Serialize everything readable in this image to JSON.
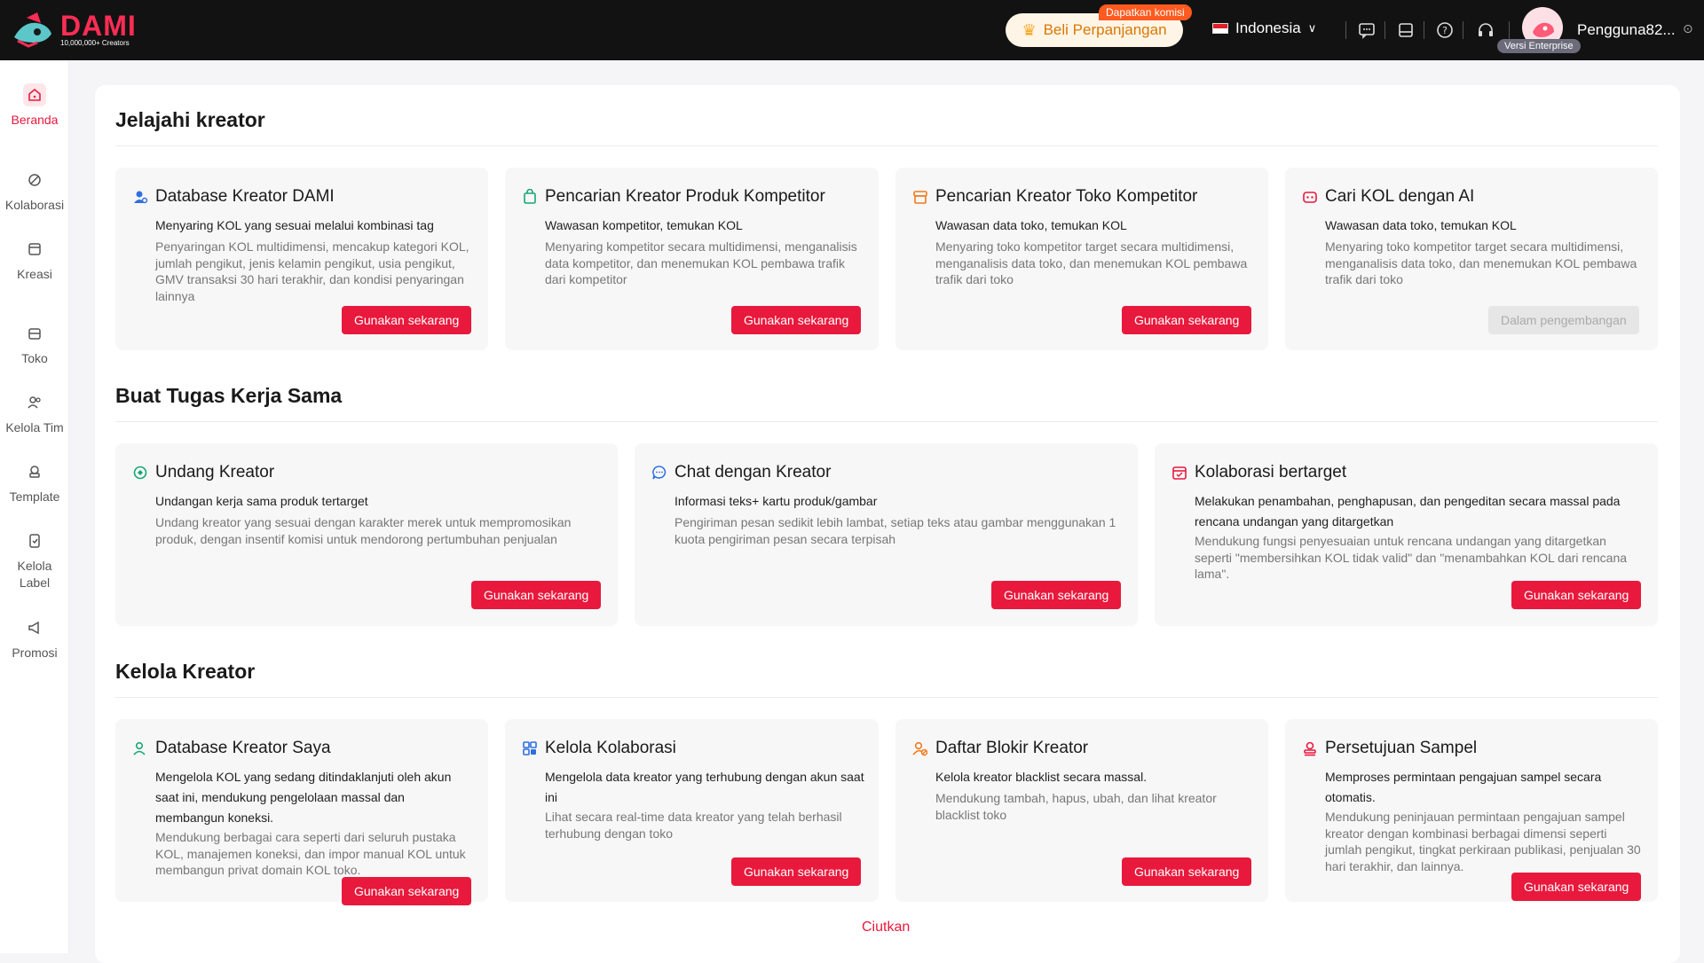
{
  "topbar": {
    "brand": "DAMI",
    "tagline": "10,000,000+ Creators",
    "renew_label": "Beli Perpanjangan",
    "commission_badge": "Dapatkan komisi",
    "language": "Indonesia",
    "username": "Pengguna82...",
    "plan_badge": "Versi Enterprise"
  },
  "sidebar": {
    "items": [
      {
        "label": "Beranda"
      },
      {
        "label": "Kolaborasi"
      },
      {
        "label": "Kreasi"
      },
      {
        "label": "Toko"
      },
      {
        "label": "Kelola Tim"
      },
      {
        "label": "Template"
      },
      {
        "label": "Kelola Label"
      },
      {
        "label": "Promosi"
      }
    ]
  },
  "sections": [
    {
      "title": "Jelajahi kreator",
      "cards": [
        {
          "title": "Database Kreator DAMI",
          "sub": "Menyaring KOL yang sesuai melalui kombinasi tag",
          "desc": "Penyaringan KOL multidimensi, mencakup kategori KOL, jumlah pengikut, jenis kelamin pengikut, usia pengikut, GMV transaksi 30 hari terakhir, dan kondisi penyaringan lainnya",
          "button": "Gunakan sekarang"
        },
        {
          "title": "Pencarian Kreator Produk Kompetitor",
          "sub": "Wawasan kompetitor, temukan KOL",
          "desc": "Menyaring kompetitor secara multidimensi, menganalisis data kompetitor, dan menemukan KOL pembawa trafik dari kompetitor",
          "button": "Gunakan sekarang"
        },
        {
          "title": "Pencarian Kreator Toko Kompetitor",
          "sub": "Wawasan data toko, temukan KOL",
          "desc": "Menyaring toko kompetitor target secara multidimensi, menganalisis data toko, dan menemukan KOL pembawa trafik dari toko",
          "button": "Gunakan sekarang"
        },
        {
          "title": "Cari KOL dengan AI",
          "sub": "Wawasan data toko, temukan KOL",
          "desc": "Menyaring toko kompetitor target secara multidimensi, menganalisis data toko, dan menemukan KOL pembawa trafik dari toko",
          "button": "Dalam pengembangan"
        }
      ]
    },
    {
      "title": "Buat Tugas Kerja Sama",
      "cards": [
        {
          "title": "Undang Kreator",
          "sub": "Undangan kerja sama produk tertarget",
          "desc": "Undang kreator yang sesuai dengan karakter merek untuk mempromosikan produk, dengan insentif komisi untuk mendorong pertumbuhan penjualan",
          "button": "Gunakan sekarang"
        },
        {
          "title": "Chat dengan Kreator",
          "sub": "Informasi teks+ kartu produk/gambar",
          "desc": "Pengiriman pesan sedikit lebih lambat, setiap teks atau gambar menggunakan 1 kuota pengiriman pesan secara terpisah",
          "button": "Gunakan sekarang"
        },
        {
          "title": "Kolaborasi bertarget",
          "sub": "Melakukan penambahan, penghapusan, dan pengeditan secara massal pada rencana undangan yang ditargetkan",
          "desc": "Mendukung fungsi penyesuaian untuk rencana undangan yang ditargetkan seperti \"membersihkan KOL tidak valid\" dan \"menambahkan KOL dari rencana lama\".",
          "button": "Gunakan sekarang"
        }
      ]
    },
    {
      "title": "Kelola Kreator",
      "cards": [
        {
          "title": "Database Kreator Saya",
          "sub": "Mengelola KOL yang sedang ditindaklanjuti oleh akun saat ini, mendukung pengelolaan massal dan membangun koneksi.",
          "desc": "Mendukung berbagai cara seperti dari seluruh pustaka KOL, manajemen koneksi, dan impor manual KOL untuk membangun privat domain KOL toko.",
          "button": "Gunakan sekarang"
        },
        {
          "title": "Kelola Kolaborasi",
          "sub": "Mengelola data kreator yang terhubung dengan akun saat ini",
          "desc": "Lihat secara real-time data kreator yang telah berhasil terhubung dengan toko",
          "button": "Gunakan sekarang"
        },
        {
          "title": "Daftar Blokir Kreator",
          "sub": "Kelola kreator blacklist secara massal.",
          "desc": "Mendukung tambah, hapus, ubah, dan lihat kreator blacklist toko",
          "button": "Gunakan sekarang"
        },
        {
          "title": "Persetujuan Sampel",
          "sub": "Memproses permintaan pengajuan sampel secara otomatis.",
          "desc": "Mendukung peninjauan permintaan pengajuan sampel kreator dengan kombinasi berbagai dimensi seperti jumlah pengikut, tingkat perkiraan publikasi, penjualan 30 hari terakhir, dan lainnya.",
          "button": "Gunakan sekarang"
        }
      ]
    }
  ],
  "collapse_label": "Ciutkan"
}
